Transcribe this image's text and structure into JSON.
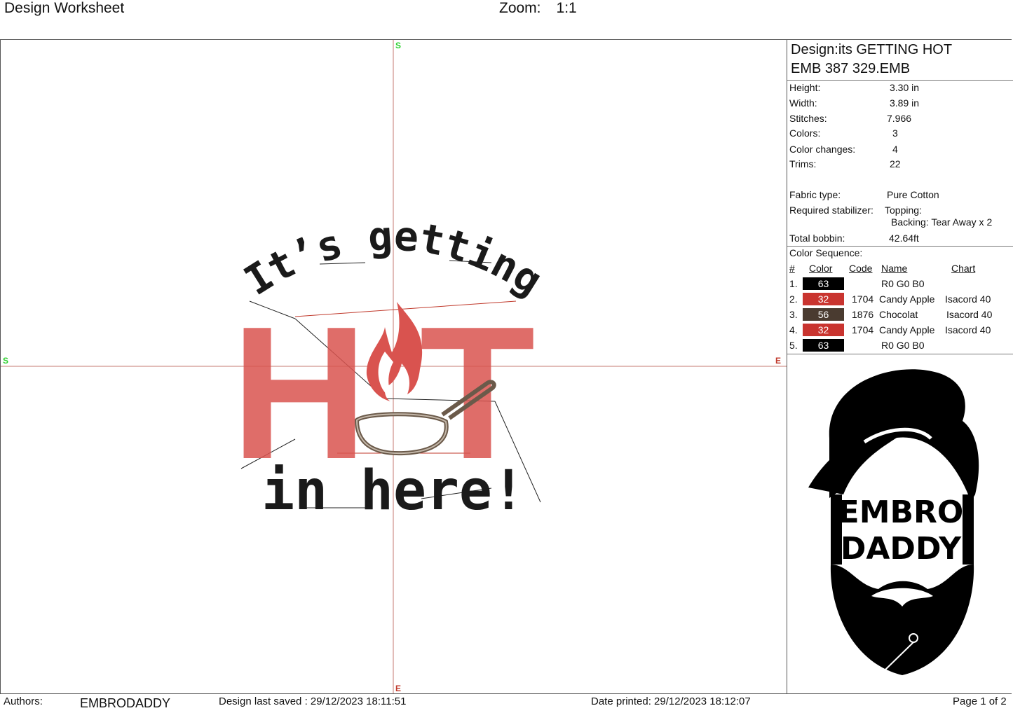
{
  "header": {
    "title": "Design Worksheet",
    "zoom_label": "Zoom:",
    "zoom_value": "1:1"
  },
  "axes": {
    "start": "S",
    "end": "E"
  },
  "design": {
    "name_line1": "Design:its GETTING HOT",
    "name_line2": "EMB 387 329.EMB",
    "artwork": {
      "line1": "It’s getting",
      "h": "H",
      "t": "T",
      "line3": "in here!",
      "black": "#1a1a1a",
      "red": "#d9534f",
      "brown": "#6b5a4a"
    }
  },
  "specs": {
    "height_label": "Height:",
    "height": "3.30 in",
    "width_label": "Width:",
    "width": "3.89 in",
    "stitches_label": "Stitches:",
    "stitches": "7.966",
    "colors_label": "Colors:",
    "colors": "3",
    "color_changes_label": "Color changes:",
    "color_changes": "4",
    "trims_label": "Trims:",
    "trims": "22",
    "fabric_label": "Fabric type:",
    "fabric": "Pure Cotton",
    "stabilizer_label": "Required stabilizer:",
    "topping": "Topping:",
    "backing": "Backing: Tear Away x 2",
    "bobbin_label": "Total bobbin:",
    "bobbin": "42.64ft"
  },
  "sequence": {
    "title": "Color Sequence:",
    "headers": {
      "num": "#",
      "color": "Color",
      "code": "Code",
      "name": "Name",
      "chart": "Chart"
    },
    "rows": [
      {
        "num": "1.",
        "swatch": "63",
        "hex": "#000000",
        "code": "",
        "name": "R0 G0 B0",
        "chart": ""
      },
      {
        "num": "2.",
        "swatch": "32",
        "hex": "#c9342f",
        "code": "1704",
        "name": "Candy Apple",
        "chart": "Isacord 40"
      },
      {
        "num": "3.",
        "swatch": "56",
        "hex": "#4a3b30",
        "code": "1876",
        "name": "Chocolat",
        "chart": "Isacord 40"
      },
      {
        "num": "4.",
        "swatch": "32",
        "hex": "#c9342f",
        "code": "1704",
        "name": "Candy Apple",
        "chart": "Isacord 40"
      },
      {
        "num": "5.",
        "swatch": "63",
        "hex": "#000000",
        "code": "",
        "name": "R0 G0 B0",
        "chart": ""
      }
    ]
  },
  "logo": {
    "line1": "EMBRO",
    "line2": "DADDY"
  },
  "footer": {
    "authors_label": "Authors:",
    "author": "EMBRODADDY",
    "saved": "Design last saved : 29/12/2023 18:11:51",
    "printed": "Date printed: 29/12/2023 18:12:07",
    "page": "Page 1 of 2"
  }
}
